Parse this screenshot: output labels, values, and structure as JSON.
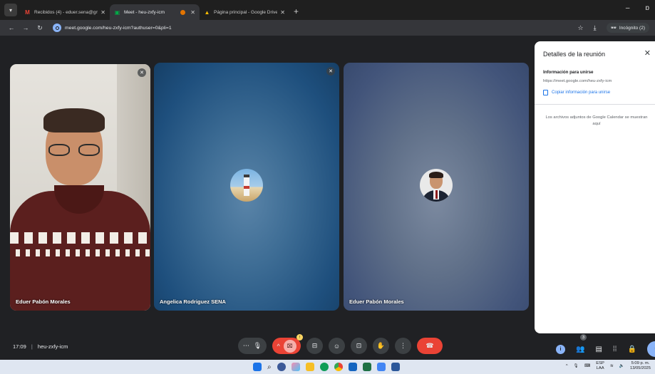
{
  "browser": {
    "tabs": [
      {
        "title": "Recibidos (4) - eduer.sena@gm",
        "favicon": "gmail-icon",
        "active": false
      },
      {
        "title": "Meet - heu-zxfy-icm",
        "favicon": "meet-icon",
        "active": true
      },
      {
        "title": "Página principal - Google Drive",
        "favicon": "drive-icon",
        "active": false
      }
    ],
    "url": "meet.google.com/heu-zxfy-icm?authuser=0&pli=1",
    "incognito_label": "Incógnito (2)"
  },
  "participants": [
    {
      "name": "Eduer Pabón Morales",
      "video": true,
      "muted": true
    },
    {
      "name": "Angelica Rodriguez SENA",
      "video": false,
      "avatar": "lighthouse-avatar",
      "muted": true
    },
    {
      "name": "Eduer Pabón Morales",
      "video": false,
      "avatar": "man-avatar",
      "muted": false
    }
  ],
  "panel": {
    "title": "Detalles de la reunión",
    "join_info_heading": "Información para unirse",
    "join_link": "https://meet.google.com/heu-zxfy-icm",
    "copy_label": "Copiar información para unirse",
    "attachments_note": "Los archivos adjuntos de Google Calendar se muestran aquí"
  },
  "bottom_bar": {
    "time": "17:09",
    "meeting_code": "heu-zxfy-icm",
    "people_count": "3",
    "camera_badge": "!"
  },
  "taskbar": {
    "lang": "ESP",
    "region": "LAA",
    "time": "5:09 p. m.",
    "date": "13/05/2025"
  },
  "colors": {
    "accent_blue": "#1a73e8",
    "end_call_red": "#ea4335",
    "camera_off_pink": "#f6aea9"
  }
}
